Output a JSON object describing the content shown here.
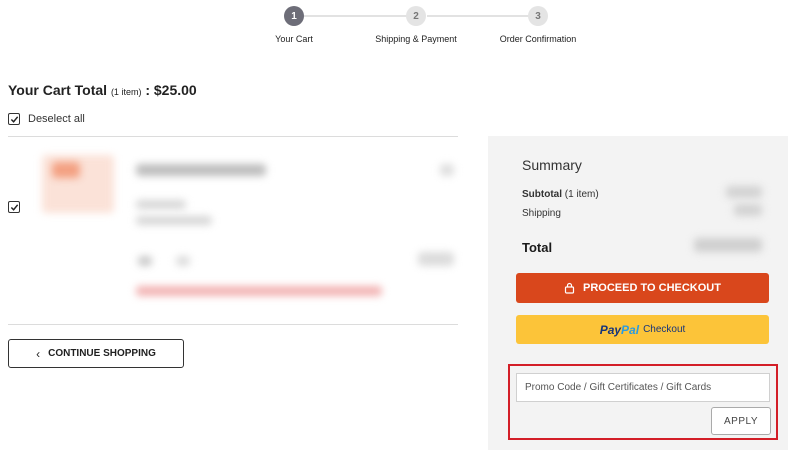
{
  "stepper": {
    "steps": [
      {
        "number": "1",
        "label": "Your Cart",
        "active": true
      },
      {
        "number": "2",
        "label": "Shipping & Payment",
        "active": false
      },
      {
        "number": "3",
        "label": "Order Confirmation",
        "active": false
      }
    ]
  },
  "cart": {
    "title": "Your Cart Total",
    "item_count": "(1 item)",
    "total_suffix": ": $25.00",
    "deselect_label": "Deselect all",
    "continue_label": "CONTINUE SHOPPING",
    "continue_icon": "chevron-left-icon"
  },
  "summary": {
    "title": "Summary",
    "subtotal_label": "Subtotal",
    "subtotal_count": "(1 item)",
    "shipping_label": "Shipping",
    "total_label": "Total",
    "checkout_label": "PROCEED TO CHECKOUT",
    "checkout_icon": "lock-icon",
    "paypal_pay": "Pay",
    "paypal_pal": "Pal",
    "paypal_checkout": "Checkout"
  },
  "promo": {
    "placeholder": "Promo Code / Gift Certificates / Gift Cards",
    "value": "",
    "apply_label": "APPLY"
  },
  "colors": {
    "checkout": "#d9471c",
    "paypal_bg": "#fcc439",
    "highlight": "#d31e27",
    "step_active": "#6d6d78"
  }
}
